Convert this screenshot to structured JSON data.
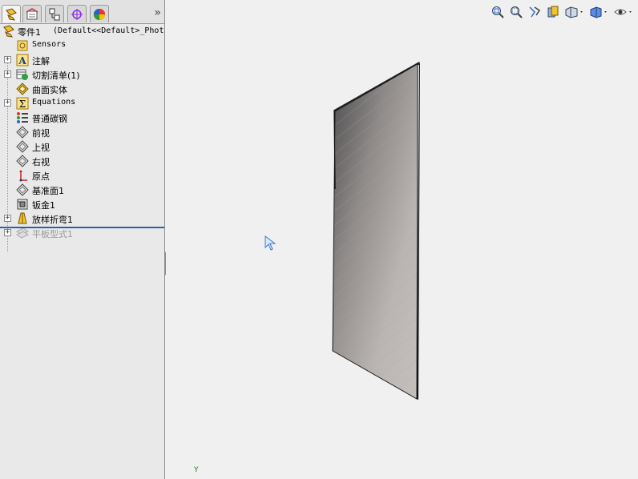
{
  "feature_manager": {
    "tabs": [
      {
        "name": "feature-tree-tab",
        "icon": "feature-tree-icon",
        "active": true
      },
      {
        "name": "property-manager-tab",
        "icon": "property-manager-icon",
        "active": false
      },
      {
        "name": "configuration-manager-tab",
        "icon": "configuration-manager-icon",
        "active": false
      },
      {
        "name": "dimxpert-tab",
        "icon": "crosshair-icon",
        "active": false
      },
      {
        "name": "display-manager-tab",
        "icon": "appearance-icon",
        "active": false
      }
    ],
    "more_label": "»",
    "root": {
      "label": "零件1",
      "config": "(Default<<Default>_Phot"
    },
    "items": [
      {
        "label": "Sensors",
        "icon": "sensors-icon",
        "expandable": false
      },
      {
        "label": "注解",
        "icon": "annotations-icon",
        "expandable": true
      },
      {
        "label": "切割清单(1)",
        "icon": "cut-list-icon",
        "expandable": true
      },
      {
        "label": "曲面实体",
        "icon": "surface-bodies-icon",
        "expandable": false
      },
      {
        "label": "Equations",
        "icon": "equations-icon",
        "expandable": true
      },
      {
        "label": "普通碳钢",
        "icon": "material-icon",
        "expandable": false
      },
      {
        "label": "前视",
        "icon": "plane-icon",
        "expandable": false
      },
      {
        "label": "上视",
        "icon": "plane-icon",
        "expandable": false
      },
      {
        "label": "右视",
        "icon": "plane-icon",
        "expandable": false
      },
      {
        "label": "原点",
        "icon": "origin-icon",
        "expandable": false
      },
      {
        "label": "基准面1",
        "icon": "plane-icon",
        "expandable": false
      },
      {
        "label": "钣金1",
        "icon": "sheet-metal-icon",
        "expandable": false
      },
      {
        "label": "放样折弯1",
        "icon": "lofted-bend-icon",
        "expandable": true
      },
      {
        "label": "平板型式1",
        "icon": "flat-pattern-icon",
        "expandable": true,
        "suppressed": true
      }
    ]
  },
  "graphics": {
    "toolbar": [
      "zoom-to-fit-icon",
      "zoom-to-area-icon",
      "previous-view-icon",
      "section-view-icon",
      "view-orientation-icon",
      "display-style-icon",
      "hide-show-icon"
    ],
    "triad_label": "Y"
  },
  "colors": {
    "pane_bg": "#e9e9e9",
    "viewport_bg": "#f0f0f0",
    "rollback_bar": "#2f5fa8",
    "part_face_dark": "#4a4a4a",
    "part_face_light": "#c4c0bc"
  }
}
